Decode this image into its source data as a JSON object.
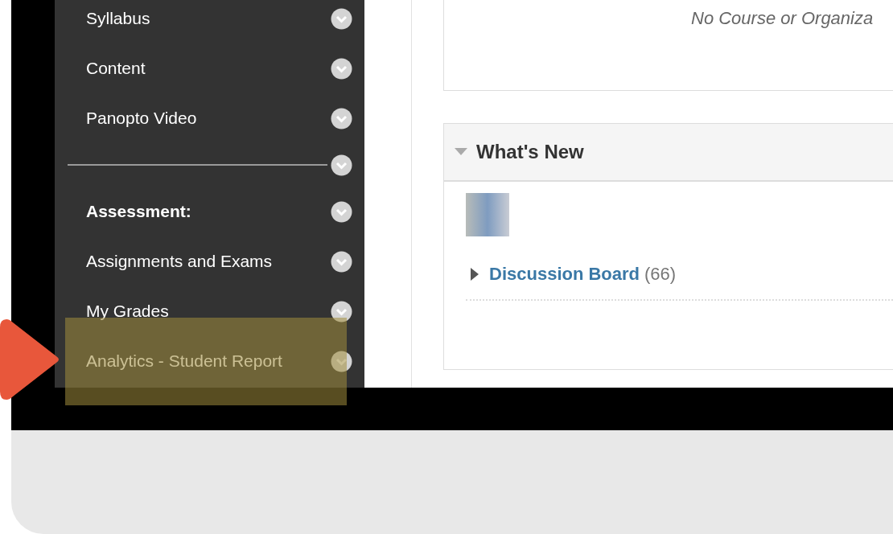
{
  "sidebar": {
    "items": [
      {
        "kind": "link",
        "label": "Syllabus",
        "highlighted": false
      },
      {
        "kind": "link",
        "label": "Content",
        "highlighted": false
      },
      {
        "kind": "link",
        "label": "Panopto Video",
        "highlighted": false
      },
      {
        "kind": "divider",
        "highlighted": false
      },
      {
        "kind": "heading",
        "label": "Assessment:",
        "highlighted": false
      },
      {
        "kind": "link",
        "label": "Assignments and Exams",
        "highlighted": false
      },
      {
        "kind": "link",
        "label": "My Grades",
        "highlighted": false
      },
      {
        "kind": "link",
        "label": "Analytics - Student Report",
        "highlighted": true
      }
    ]
  },
  "courses_panel": {
    "message": "No Course or Organiza"
  },
  "whats_new": {
    "title": "What's New",
    "expanded": true,
    "items": [
      {
        "label": "Discussion Board",
        "count": "(66)",
        "expanded": false
      }
    ]
  }
}
